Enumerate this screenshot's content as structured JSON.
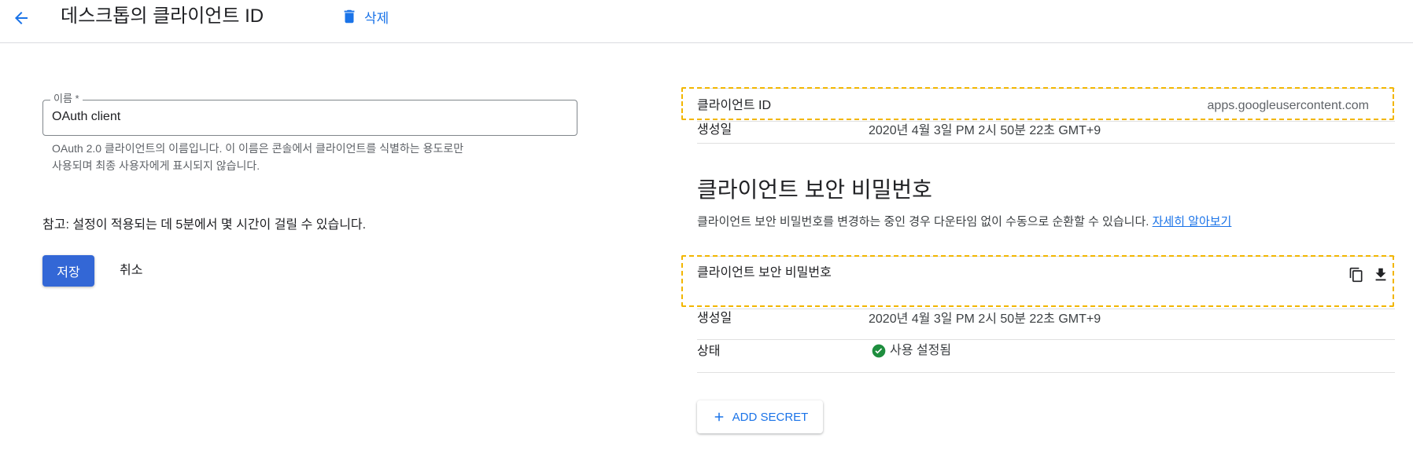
{
  "header": {
    "back_icon": "arrow-back-icon",
    "title": "데스크톱의 클라이언트 ID",
    "delete_icon": "trash-icon",
    "delete_label": "삭제"
  },
  "form": {
    "name_label": "이름 *",
    "name_value": "OAuth client",
    "name_help_line1": "OAuth 2.0 클라이언트의 이름입니다. 이 이름은 콘솔에서 클라이언트를 식별하는 용도로만",
    "name_help_line2": "사용되며 최종 사용자에게 표시되지 않습니다.",
    "note": "참고: 설정이 적용되는 데 5분에서 몇 시간이 걸릴 수 있습니다.",
    "save_label": "저장",
    "cancel_label": "취소"
  },
  "client_info": {
    "client_id_label": "클라이언트 ID",
    "client_id_value": "apps.googleusercontent.com",
    "created_label": "생성일",
    "created_value": "2020년 4월 3일 PM 2시 50분 22초 GMT+9"
  },
  "secret_section": {
    "title": "클라이언트 보안 비밀번호",
    "description": "클라이언트 보안 비밀번호를 변경하는 중인 경우 다운타임 없이 수동으로 순환할 수 있습니다.",
    "learn_more": "자세히 알아보기",
    "secret_label": "클라이언트 보안 비밀번호",
    "copy_icon": "copy-icon",
    "download_icon": "download-icon",
    "created_label": "생성일",
    "created_value": "2020년 4월 3일 PM 2시 50분 22초 GMT+9",
    "status_label": "상태",
    "status_icon": "check-circle-icon",
    "status_value": "사용 설정됨",
    "add_icon": "plus-icon",
    "add_label": "ADD SECRET"
  },
  "colors": {
    "accent": "#1a73e8",
    "primary_button": "#3367d6",
    "highlight_dash": "#f2b600",
    "success": "#1e8e3e"
  }
}
